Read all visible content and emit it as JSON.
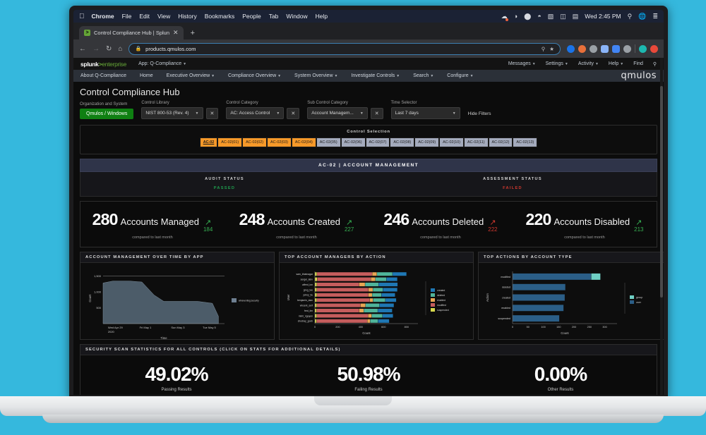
{
  "macos_menubar": {
    "apple_icon": "apple-icon",
    "items": [
      "Chrome",
      "File",
      "Edit",
      "View",
      "History",
      "Bookmarks",
      "People",
      "Tab",
      "Window",
      "Help"
    ],
    "status_icons": [
      "dropbox-icon",
      "moon-icon",
      "cloud-icon",
      "wifi-icon",
      "us-flag-icon",
      "airplay-icon",
      "battery-icon"
    ],
    "clock": "Wed 2:45 PM",
    "right_icons": [
      "search-icon",
      "globe-icon",
      "control-center-icon"
    ]
  },
  "browser": {
    "tab_title": "Control Compliance Hub | Splun",
    "tab_favicon": ">",
    "close_label": "✕",
    "new_tab_label": "+",
    "back_icon": "←",
    "forward_icon": "→",
    "reload_icon": "↻",
    "home_icon": "⌂",
    "lock_icon": "🔒",
    "url": "products.qmulos.com",
    "omnibox_icons": [
      "zoom-icon",
      "bookmark-star-icon"
    ],
    "extension_colors": [
      "#1a73e8",
      "#e8703a",
      "#9aa0a6",
      "#8ab4f8",
      "#4285f4",
      "#9aa0a6",
      "#1db8b0",
      "#e8493a"
    ]
  },
  "splunk_header": {
    "logo": "splunk",
    "logo_arrow": ">",
    "logo_enterprise": "enterprise",
    "app_label": "App: Q-Compliance",
    "right_items": [
      "Messages",
      "Settings",
      "Activity",
      "Help",
      "Find"
    ],
    "search_icon": "search-icon"
  },
  "splunk_nav": {
    "items": [
      {
        "label": "About Q-Compliance",
        "caret": false
      },
      {
        "label": "Home",
        "caret": false
      },
      {
        "label": "Executive Overview",
        "caret": true
      },
      {
        "label": "Compliance Overview",
        "caret": true
      },
      {
        "label": "System Overview",
        "caret": true
      },
      {
        "label": "Investigate Controls",
        "caret": true
      },
      {
        "label": "Search",
        "caret": true
      },
      {
        "label": "Configure",
        "caret": true
      }
    ],
    "brand": "qmulos"
  },
  "dashboard": {
    "title": "Control Compliance Hub",
    "filters": [
      {
        "label": "Organization and System",
        "value": "Qmulos / Windows",
        "type": "pill"
      },
      {
        "label": "Control Library",
        "value": "NIST 800-53 (Rev. 4)",
        "type": "select",
        "clear": "✕"
      },
      {
        "label": "Control Category",
        "value": "AC: Access Control",
        "type": "select",
        "clear": "✕"
      },
      {
        "label": "Sub Control Category",
        "value": "Account Managem...",
        "type": "select",
        "clear": "✕"
      },
      {
        "label": "Time Selector",
        "value": "Last 7 days",
        "type": "select"
      }
    ],
    "hide_filters": "Hide Filters",
    "control_selection": {
      "title": "Control Selection",
      "chips": [
        {
          "label": "AC-02",
          "state": "on",
          "selected": true
        },
        {
          "label": "AC-02(01)",
          "state": "on",
          "selected": false
        },
        {
          "label": "AC-02(02)",
          "state": "on",
          "selected": false
        },
        {
          "label": "AC-02(03)",
          "state": "on",
          "selected": false
        },
        {
          "label": "AC-02(04)",
          "state": "on",
          "selected": false
        },
        {
          "label": "AC-02(05)",
          "state": "off",
          "selected": false
        },
        {
          "label": "AC-02(06)",
          "state": "off",
          "selected": false
        },
        {
          "label": "AC-02(07)",
          "state": "off",
          "selected": false
        },
        {
          "label": "AC-02(08)",
          "state": "off",
          "selected": false
        },
        {
          "label": "AC-02(09)",
          "state": "off",
          "selected": false
        },
        {
          "label": "AC-02(10)",
          "state": "off",
          "selected": false
        },
        {
          "label": "AC-02(11)",
          "state": "off",
          "selected": false
        },
        {
          "label": "AC-02(12)",
          "state": "off",
          "selected": false
        },
        {
          "label": "AC-02(13)",
          "state": "off",
          "selected": false
        }
      ]
    },
    "control_title": "AC-02 | ACCOUNT MANAGEMENT",
    "statuses": [
      {
        "label": "AUDIT STATUS",
        "value": "PASSED",
        "state": "pass"
      },
      {
        "label": "ASSESSMENT STATUS",
        "value": "FAILED",
        "state": "fail"
      }
    ],
    "kpis": [
      {
        "number": "280",
        "label": "Accounts Managed",
        "prev": "184",
        "direction": "up",
        "arrow": "↗",
        "sub": "compared to last month"
      },
      {
        "number": "248",
        "label": "Accounts Created",
        "prev": "227",
        "direction": "up",
        "arrow": "↗",
        "sub": "compared to last month"
      },
      {
        "number": "246",
        "label": "Accounts Deleted",
        "prev": "222",
        "direction": "down",
        "arrow": "↗",
        "sub": "compared to last month"
      },
      {
        "number": "220",
        "label": "Accounts Disabled",
        "prev": "213",
        "direction": "up",
        "arrow": "↗",
        "sub": "compared to last month"
      }
    ],
    "bottom_panel": {
      "title": "SECURITY SCAN STATISTICS FOR ALL CONTROLS (CLICK ON STATS FOR ADDITIONAL DETAILS)",
      "stats": [
        {
          "value": "49.02%",
          "label": "Passing Results"
        },
        {
          "value": "50.98%",
          "label": "Failing Results"
        },
        {
          "value": "0.00%",
          "label": "Other Results"
        }
      ]
    }
  },
  "chart_data": [
    {
      "type": "area",
      "title": "ACCOUNT MANAGEMENT OVER TIME BY APP",
      "xlabel": "Time",
      "ylabel": "Count",
      "ylim": [
        0,
        1600
      ],
      "yticks": [
        500,
        1000,
        1500
      ],
      "xticks": [
        "Wed Apr 29\n2020",
        "Fri May 1",
        "Sun May 3",
        "Tue May 5"
      ],
      "legend": [
        {
          "name": "wineventlog:security",
          "color": "#6e7f91"
        }
      ],
      "grid": false,
      "series": [
        {
          "name": "wineventlog:security",
          "color": "#6e7f91",
          "x": [
            0,
            0.08,
            0.22,
            0.32,
            0.42,
            0.5,
            0.78,
            0.9,
            0.95
          ],
          "values": [
            1280,
            1340,
            1340,
            1310,
            900,
            700,
            700,
            640,
            230
          ]
        }
      ]
    },
    {
      "type": "bar",
      "orientation": "horizontal",
      "stacked": true,
      "title": "TOP ACCOUNT MANAGERS BY ACTION",
      "xlabel": "Count",
      "ylabel": "User",
      "xlim": [
        0,
        900
      ],
      "xticks": [
        0,
        200,
        400,
        600,
        800
      ],
      "categories": [
        "sam_bhatnagar",
        "sergei_lahv",
        "alfred_lon",
        "greg_lee",
        "johny_liu",
        "benjamin_stax",
        "vincent_serf",
        "fred_lim",
        "mimi_nguyen",
        "chodray_gosh"
      ],
      "legend_position": "right",
      "series": [
        {
          "name": "suspended",
          "color": "#d6d84c",
          "values": [
            18,
            20,
            18,
            16,
            18,
            16,
            16,
            15,
            16,
            15
          ]
        },
        {
          "name": "modified",
          "color": "#c55d5d",
          "values": [
            482,
            468,
            368,
            452,
            448,
            462,
            382,
            372,
            448,
            442
          ]
        },
        {
          "name": "enabled",
          "color": "#e8a553",
          "values": [
            42,
            40,
            52,
            38,
            34,
            30,
            44,
            40,
            32,
            26
          ]
        },
        {
          "name": "deleted",
          "color": "#4fb49a",
          "values": [
            136,
            96,
            118,
            88,
            82,
            108,
            122,
            122,
            94,
            68
          ]
        },
        {
          "name": "created",
          "color": "#1f77b4",
          "values": [
            122,
            96,
            166,
            126,
            118,
            94,
            126,
            126,
            92,
            98
          ]
        }
      ]
    },
    {
      "type": "bar",
      "orientation": "horizontal",
      "stacked": true,
      "title": "TOP ACTIONS BY ACCOUNT TYPE",
      "xlabel": "Count",
      "ylabel": "Action",
      "xlim": [
        0,
        340
      ],
      "xticks": [
        0,
        50,
        100,
        150,
        200,
        250,
        300
      ],
      "categories": [
        "modified",
        "deleted",
        "created",
        "enabled",
        "suspended"
      ],
      "legend_position": "right",
      "series": [
        {
          "name": "user",
          "color": "#2b5e87",
          "values": [
            256,
            172,
            170,
            166,
            152
          ]
        },
        {
          "name": "group",
          "color": "#6fcfc4",
          "values": [
            30,
            0,
            0,
            0,
            0
          ]
        }
      ]
    }
  ]
}
